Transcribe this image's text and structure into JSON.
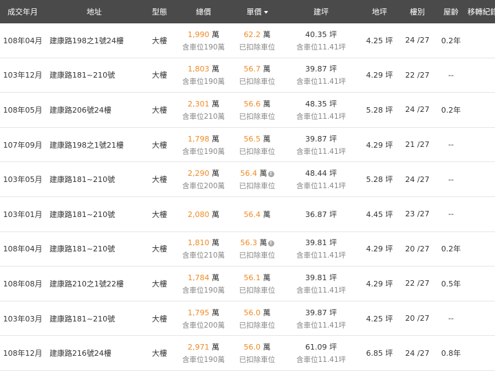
{
  "columns": [
    "成交年月",
    "地址",
    "型態",
    "總價",
    "單價",
    "建坪",
    "地坪",
    "樓別",
    "屋齡",
    "移轉紀錄"
  ],
  "rows": [
    {
      "date": "108年04月",
      "address": "建康路198之1號24樓",
      "type": "大樓",
      "total": "1,990",
      "total_unit": "萬",
      "total_note": "含車位190萬",
      "unit_price": "62.2",
      "unit_price_unit": "萬",
      "unit_note": "已扣除車位",
      "info": false,
      "area": "40.35 坪",
      "area_note": "含車位11.41坪",
      "land": "4.25 坪",
      "floor": "24 /27",
      "age": "0.2年"
    },
    {
      "date": "103年12月",
      "address": "建康路181~210號",
      "type": "大樓",
      "total": "1,803",
      "total_unit": "萬",
      "total_note": "含車位190萬",
      "unit_price": "56.7",
      "unit_price_unit": "萬",
      "unit_note": "已扣除車位",
      "info": false,
      "area": "39.87 坪",
      "area_note": "含車位11.41坪",
      "land": "4.29 坪",
      "floor": "22 /27",
      "age": "--"
    },
    {
      "date": "108年05月",
      "address": "建康路206號24樓",
      "type": "大樓",
      "total": "2,301",
      "total_unit": "萬",
      "total_note": "含車位210萬",
      "unit_price": "56.6",
      "unit_price_unit": "萬",
      "unit_note": "已扣除車位",
      "info": false,
      "area": "48.35 坪",
      "area_note": "含車位11.41坪",
      "land": "5.28 坪",
      "floor": "24 /27",
      "age": "0.2年"
    },
    {
      "date": "107年09月",
      "address": "建康路198之1號21樓",
      "type": "大樓",
      "total": "1,798",
      "total_unit": "萬",
      "total_note": "含車位190萬",
      "unit_price": "56.5",
      "unit_price_unit": "萬",
      "unit_note": "已扣除車位",
      "info": false,
      "area": "39.87 坪",
      "area_note": "含車位11.41坪",
      "land": "4.29 坪",
      "floor": "21 /27",
      "age": "--"
    },
    {
      "date": "103年05月",
      "address": "建康路181~210號",
      "type": "大樓",
      "total": "2,290",
      "total_unit": "萬",
      "total_note": "含車位200萬",
      "unit_price": "56.4",
      "unit_price_unit": "萬",
      "unit_note": "已扣除車位",
      "info": true,
      "area": "48.44 坪",
      "area_note": "含車位11.41坪",
      "land": "5.28 坪",
      "floor": "24 /27",
      "age": "--"
    },
    {
      "date": "103年01月",
      "address": "建康路181~210號",
      "type": "大樓",
      "total": "2,080",
      "total_unit": "萬",
      "total_note": "",
      "unit_price": "56.4",
      "unit_price_unit": "萬",
      "unit_note": "",
      "info": false,
      "area": "36.87 坪",
      "area_note": "",
      "land": "4.45 坪",
      "floor": "23 /27",
      "age": "--"
    },
    {
      "date": "108年04月",
      "address": "建康路181~210號",
      "type": "大樓",
      "total": "1,810",
      "total_unit": "萬",
      "total_note": "含車位210萬",
      "unit_price": "56.3",
      "unit_price_unit": "萬",
      "unit_note": "已扣除車位",
      "info": true,
      "area": "39.81 坪",
      "area_note": "含車位11.41坪",
      "land": "4.29 坪",
      "floor": "20 /27",
      "age": "0.2年"
    },
    {
      "date": "108年08月",
      "address": "建康路210之1號22樓",
      "type": "大樓",
      "total": "1,784",
      "total_unit": "萬",
      "total_note": "含車位190萬",
      "unit_price": "56.1",
      "unit_price_unit": "萬",
      "unit_note": "已扣除車位",
      "info": false,
      "area": "39.81 坪",
      "area_note": "含車位11.41坪",
      "land": "4.29 坪",
      "floor": "22 /27",
      "age": "0.5年"
    },
    {
      "date": "103年03月",
      "address": "建康路181~210號",
      "type": "大樓",
      "total": "1,795",
      "total_unit": "萬",
      "total_note": "含車位200萬",
      "unit_price": "56.0",
      "unit_price_unit": "萬",
      "unit_note": "已扣除車位",
      "info": false,
      "area": "39.87 坪",
      "area_note": "含車位11.41坪",
      "land": "4.25 坪",
      "floor": "20 /27",
      "age": "--"
    },
    {
      "date": "108年12月",
      "address": "建康路216號24樓",
      "type": "大樓",
      "total": "2,971",
      "total_unit": "萬",
      "total_note": "含車位190萬",
      "unit_price": "56.0",
      "unit_price_unit": "萬",
      "unit_note": "已扣除車位",
      "info": false,
      "area": "61.09 坪",
      "area_note": "含車位11.41坪",
      "land": "6.85 坪",
      "floor": "24 /27",
      "age": "0.8年"
    }
  ],
  "info_icon_glyph": "!",
  "colors": {
    "accent": "#f08a24",
    "header_bg": "#4a4a4a"
  }
}
